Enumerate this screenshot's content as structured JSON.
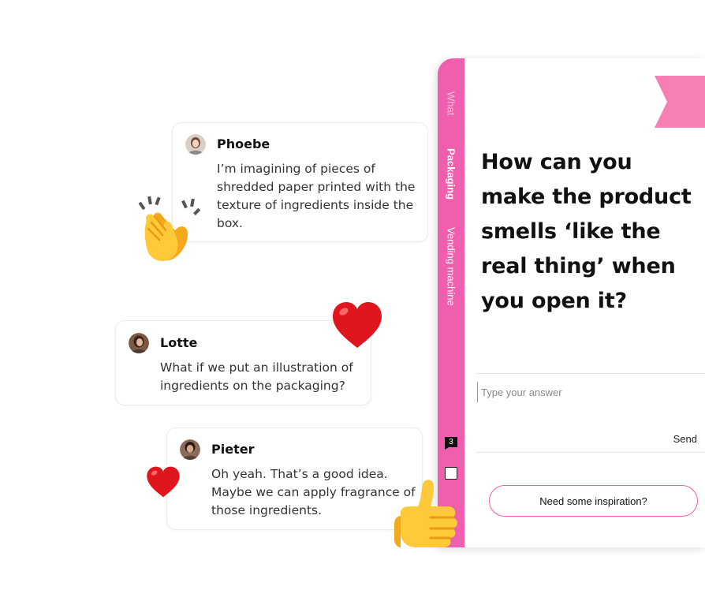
{
  "chat": {
    "messages": [
      {
        "name": "Phoebe",
        "text": "I’m imagining of pieces of shredded paper printed with the texture of ingredients inside the box."
      },
      {
        "name": "Lotte",
        "text": "What if we put an illustration of ingredients on the packaging?"
      },
      {
        "name": "Pieter",
        "text": "Oh yeah. That’s a good idea. Maybe we can apply fragrance of those ingredients."
      }
    ]
  },
  "reactions": {
    "clap": "clapping-hands-icon",
    "heart_big": "red-heart-icon",
    "heart_small": "red-heart-icon",
    "thumbs_up": "thumbs-up-icon"
  },
  "app": {
    "tabs": [
      {
        "label": "What",
        "active": false
      },
      {
        "label": "Packaging",
        "active": true
      },
      {
        "label": "Vending machine",
        "active": false
      }
    ],
    "comment_count": "3",
    "question": "How can you make the product smells ‘like the real thing’ when you open it?",
    "answer": {
      "placeholder": "Type your answer",
      "value": ""
    },
    "send_label": "Send",
    "inspiration_label": "Need some inspiration?"
  },
  "colors": {
    "accent": "#ef5fad",
    "ribbon": "#f77fb5",
    "card_border": "#ececec",
    "text": "#111111"
  }
}
